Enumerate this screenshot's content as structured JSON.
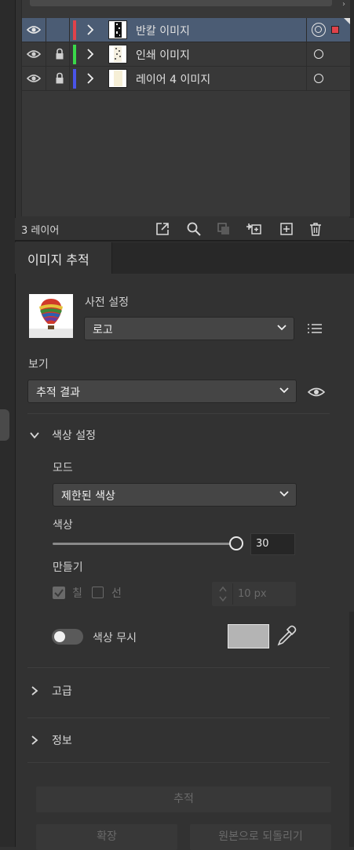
{
  "layers_panel": {
    "layers": [
      {
        "name": "반칼 이미지",
        "color": "#e0424a",
        "selected": true,
        "locked": false
      },
      {
        "name": "인쇄 이미지",
        "color": "#3ad84a",
        "selected": false,
        "locked": true
      },
      {
        "name": "레이어 4 이미지",
        "color": "#4a54e8",
        "selected": false,
        "locked": true
      }
    ],
    "count_label": "3 레이어"
  },
  "trace_panel": {
    "tab_label": "이미지 추적",
    "preset_label": "사전 설정",
    "preset_value": "로고",
    "view_label": "보기",
    "view_value": "추적 결과",
    "color_settings_label": "색상 설정",
    "mode_label": "모드",
    "mode_value": "제한된 색상",
    "colors_label": "색상",
    "colors_value": "30",
    "create_label": "만들기",
    "fill_label": "칠",
    "stroke_label": "선",
    "stroke_width_value": "10 px",
    "ignore_color_label": "색상 무시",
    "ignore_color_swatch": "#b4b4b4",
    "advanced_label": "고급",
    "info_label": "정보",
    "trace_button": "추적",
    "expand_button": "확장",
    "revert_button": "원본으로 되돌리기"
  },
  "colors": {
    "accent_selection": "#4b5c74"
  }
}
